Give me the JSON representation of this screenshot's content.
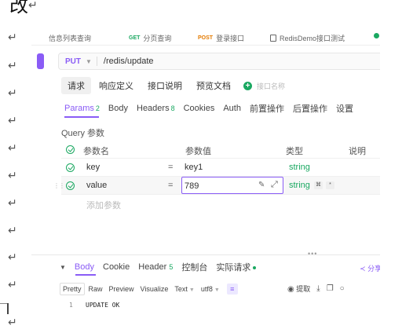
{
  "document": {
    "heading_char": "改",
    "heading_cut_text": "…………",
    "paragraph_mark": "↵"
  },
  "tabs": [
    {
      "label": "信息列表查询",
      "verb": "",
      "icon": "list-icon"
    },
    {
      "label": "分页查询",
      "verb": "GET",
      "icon": ""
    },
    {
      "label": "登录接口",
      "verb": "POST",
      "icon": ""
    },
    {
      "label": "RedisDemo接口测试",
      "verb": "",
      "icon": "document-icon"
    }
  ],
  "request": {
    "method": "PUT",
    "url": "/redis/update"
  },
  "request_tabs": [
    "请求",
    "响应定义",
    "接口说明",
    "预览文档"
  ],
  "interface_name_placeholder": "接口名称",
  "param_tabs": [
    {
      "label": "Params",
      "count": "2"
    },
    {
      "label": "Body",
      "count": ""
    },
    {
      "label": "Headers",
      "count": "8"
    },
    {
      "label": "Cookies",
      "count": ""
    },
    {
      "label": "Auth",
      "count": ""
    },
    {
      "label": "前置操作",
      "count": ""
    },
    {
      "label": "后置操作",
      "count": ""
    },
    {
      "label": "设置",
      "count": ""
    }
  ],
  "query_section_title": "Query 参数",
  "columns": {
    "name": "参数名",
    "value": "参数值",
    "type": "类型",
    "desc": "说明"
  },
  "params": [
    {
      "name": "key",
      "eq": "=",
      "value": "key1",
      "type": "string"
    },
    {
      "name": "value",
      "eq": "=",
      "value": "789",
      "type": "string"
    }
  ],
  "add_param_placeholder": "添加参数",
  "response_tabs": [
    {
      "label": "Body",
      "count": ""
    },
    {
      "label": "Cookie",
      "count": ""
    },
    {
      "label": "Header",
      "count": "5"
    },
    {
      "label": "控制台",
      "count": ""
    },
    {
      "label": "实际请求",
      "count": ""
    }
  ],
  "share_label": "分享",
  "format_options": [
    "Pretty",
    "Raw",
    "Preview",
    "Visualize"
  ],
  "format_type": "Text",
  "encoding": "utf8",
  "extract_label": "提取",
  "response_body": {
    "line_number": "1",
    "text": "UPDATE OK"
  },
  "colors": {
    "accent": "#8a5cf6",
    "success": "#1aa861",
    "post": "#e47a00"
  }
}
